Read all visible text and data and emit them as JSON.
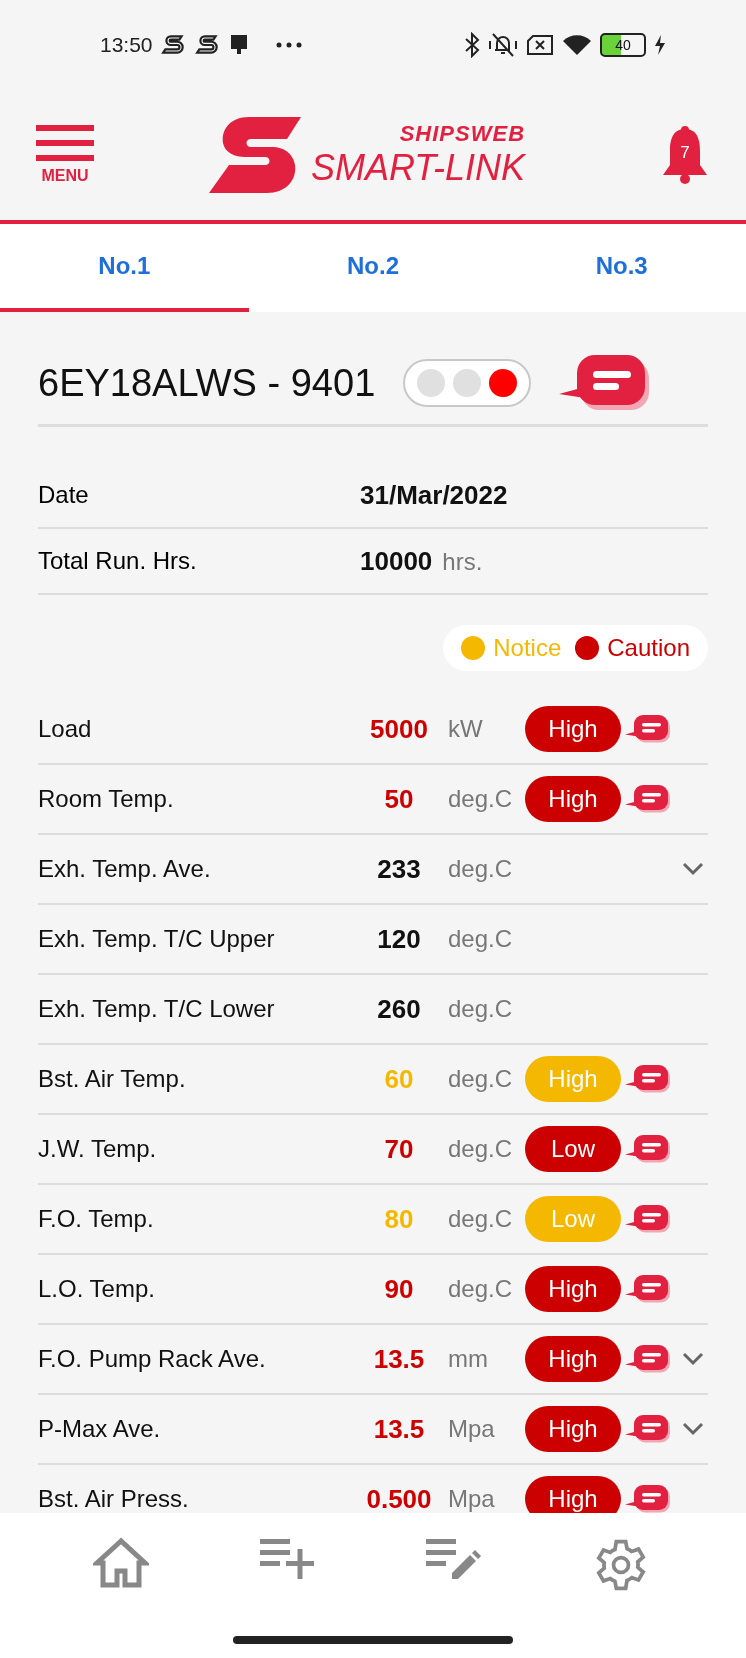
{
  "status_bar": {
    "time": "13:50",
    "battery": "40"
  },
  "header": {
    "menu_label": "MENU",
    "brand_top": "SHIPSWEB",
    "brand_name": "SMART-LINK",
    "notification_count": "7"
  },
  "tabs": [
    {
      "label": "No.1",
      "selected": true
    },
    {
      "label": "No.2",
      "selected": false
    },
    {
      "label": "No.3",
      "selected": false
    }
  ],
  "engine": {
    "title": "6EY18ALWS - 9401",
    "lights": [
      {
        "on": false
      },
      {
        "on": false
      },
      {
        "on": true
      }
    ]
  },
  "info": [
    {
      "label": "Date",
      "value": "31/Mar/2022"
    },
    {
      "label": "Total Run. Hrs.",
      "value": "10000",
      "unit": "hrs."
    }
  ],
  "legend": [
    {
      "label": "Notice",
      "color": "#f5b800"
    },
    {
      "label": "Caution",
      "color": "#cc0000"
    }
  ],
  "rows": [
    {
      "label": "Load",
      "value": "5000",
      "unit": "kW",
      "color": "#cc0000",
      "status": "High",
      "expandable": false
    },
    {
      "label": "Room Temp.",
      "value": "50",
      "unit": "deg.C",
      "color": "#cc0000",
      "status": "High",
      "expandable": false
    },
    {
      "label": "Exh. Temp. Ave.",
      "value": "233",
      "unit": "deg.C",
      "expandable": true
    },
    {
      "label": "Exh. Temp. T/C Upper",
      "value": "120",
      "unit": "deg.C",
      "expandable": false
    },
    {
      "label": "Exh. Temp. T/C Lower",
      "value": "260",
      "unit": "deg.C",
      "expandable": false
    },
    {
      "label": "Bst. Air Temp.",
      "value": "60",
      "unit": "deg.C",
      "color": "#f5b800",
      "status": "High",
      "expandable": false
    },
    {
      "label": "J.W. Temp.",
      "value": "70",
      "unit": "deg.C",
      "color": "#cc0000",
      "status": "Low",
      "expandable": false
    },
    {
      "label": "F.O. Temp.",
      "value": "80",
      "unit": "deg.C",
      "color": "#f5b800",
      "status": "Low",
      "expandable": false
    },
    {
      "label": "L.O. Temp.",
      "value": "90",
      "unit": "deg.C",
      "color": "#cc0000",
      "status": "High",
      "expandable": false
    },
    {
      "label": "F.O. Pump Rack Ave.",
      "value": "13.5",
      "unit": "mm",
      "color": "#cc0000",
      "status": "High",
      "expandable": true
    },
    {
      "label": "P-Max Ave.",
      "value": "13.5",
      "unit": "Mpa",
      "color": "#cc0000",
      "status": "High",
      "expandable": true
    },
    {
      "label": "Bst. Air Press.",
      "value": "0.500",
      "unit": "Mpa",
      "color": "#cc0000",
      "status": "High",
      "expandable": false
    }
  ],
  "nav": [
    {
      "kind": "home"
    },
    {
      "kind": "add-list"
    },
    {
      "kind": "edit-list"
    },
    {
      "kind": "settings"
    }
  ]
}
